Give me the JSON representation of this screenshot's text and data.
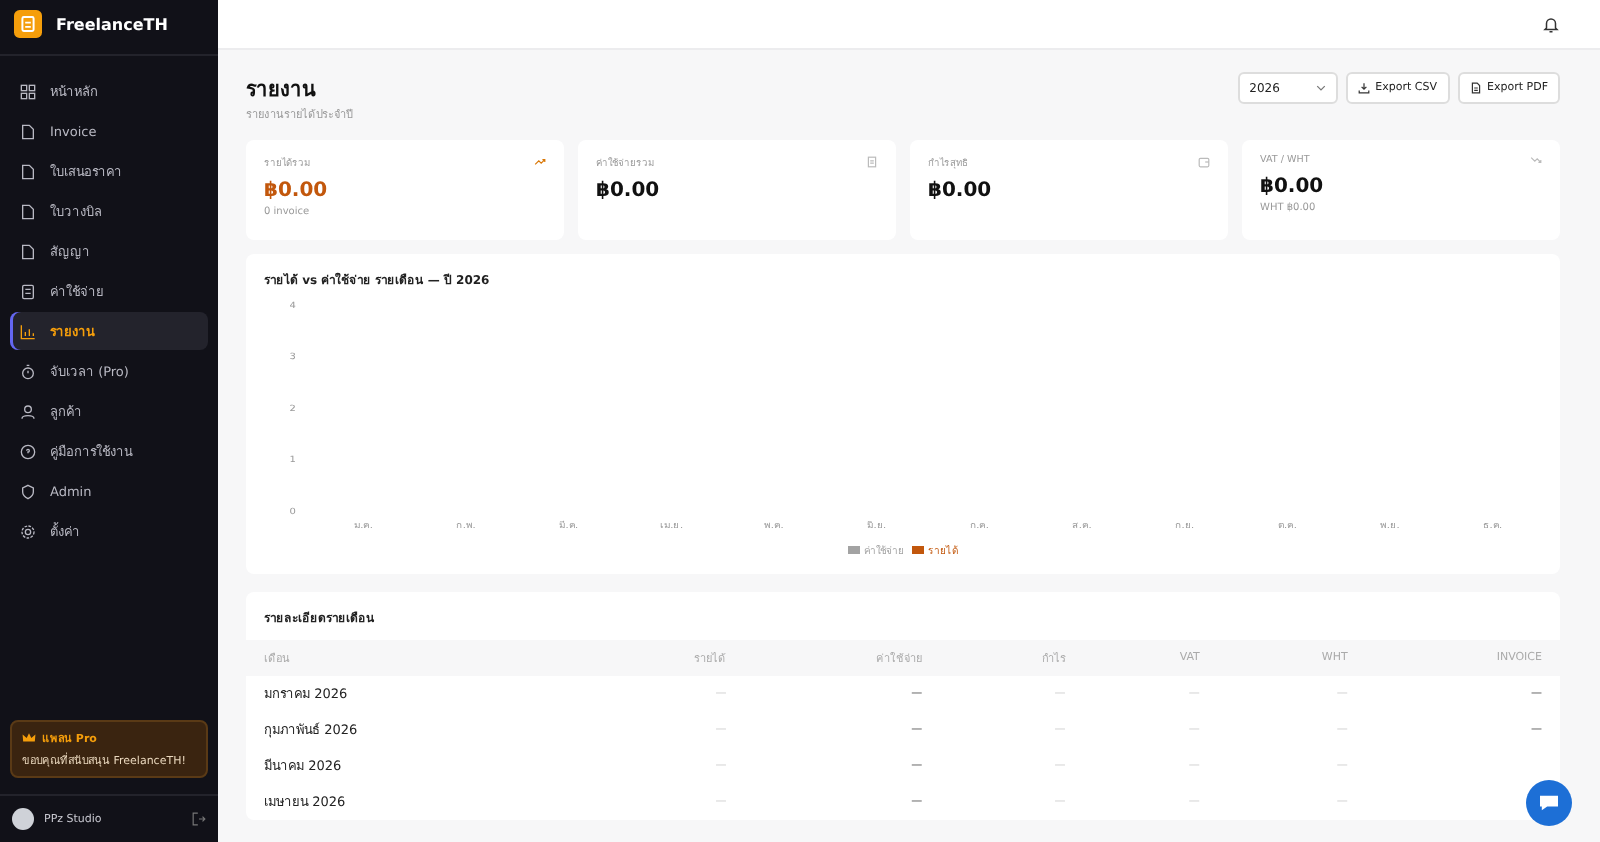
{
  "brand": {
    "name": "FreelanceTH"
  },
  "sidebar": {
    "items": [
      {
        "label": "หน้าหลัก",
        "selected": false
      },
      {
        "label": "Invoice",
        "selected": false
      },
      {
        "label": "ใบเสนอราคา",
        "selected": false
      },
      {
        "label": "ใบวางบิล",
        "selected": false
      },
      {
        "label": "สัญญา",
        "selected": false
      },
      {
        "label": "ค่าใช้จ่าย",
        "selected": false
      },
      {
        "label": "รายงาน",
        "selected": true
      },
      {
        "label": "จับเวลา (Pro)",
        "selected": false
      },
      {
        "label": "ลูกค้า",
        "selected": false
      },
      {
        "label": "คู่มือการใช้งาน",
        "selected": false
      },
      {
        "label": "Admin",
        "selected": false
      },
      {
        "label": "ตั้งค่า",
        "selected": false
      }
    ],
    "plan": {
      "title": "แพลน Pro",
      "text": "ขอบคุณที่สนับสนุน FreelanceTH!"
    },
    "user": {
      "name": "PPz Studio"
    }
  },
  "page": {
    "title": "รายงาน",
    "subtitle": "รายงานรายได้ประจำปี",
    "year": "2026",
    "buttons": [
      "Export CSV",
      "Export PDF"
    ]
  },
  "cards": [
    {
      "label": "รายได้รวม",
      "value": "฿0.00",
      "note": "0 invoice",
      "kind": "income"
    },
    {
      "label": "ค่าใช้จ่ายรวม",
      "value": "฿0.00",
      "kind": "expense"
    },
    {
      "label": "กำไรสุทธิ",
      "value": "฿0.00",
      "kind": "profit"
    },
    {
      "label": "VAT / WHT",
      "value": "฿0.00",
      "note": "WHT ฿0.00",
      "kind": "tax"
    }
  ],
  "chart": {
    "chart_data": {
      "type": "bar",
      "title": "รายได้ vs ค่าใช้จ่าย รายเดือน — ปี 2026",
      "categories": [
        "ม.ค.",
        "ก.พ.",
        "มี.ค.",
        "เม.ย.",
        "พ.ค.",
        "มิ.ย.",
        "ก.ค.",
        "ส.ค.",
        "ก.ย.",
        "ต.ค.",
        "พ.ย.",
        "ธ.ค."
      ],
      "series": [
        {
          "name": "ค่าใช้จ่าย",
          "color": "#a3a3a3",
          "values": [
            0,
            0,
            0,
            0,
            0,
            0,
            0,
            0,
            0,
            0,
            0,
            0
          ]
        },
        {
          "name": "รายได้",
          "color": "#c2570c",
          "values": [
            0,
            0,
            0,
            0,
            0,
            0,
            0,
            0,
            0,
            0,
            0,
            0
          ]
        }
      ],
      "ylim": [
        0,
        4
      ],
      "yticks": [
        0,
        1,
        2,
        3,
        4
      ]
    }
  },
  "table": {
    "title": "รายละเอียดรายเดือน",
    "columns": [
      "เดือน",
      "รายได้",
      "ค่าใช้จ่าย",
      "กำไร",
      "VAT",
      "WHT",
      "INVOICE"
    ],
    "rows": [
      [
        "มกราคม 2026",
        "—",
        "—",
        "—",
        "—",
        "—",
        "—"
      ],
      [
        "กุมภาพันธ์ 2026",
        "—",
        "—",
        "—",
        "—",
        "—",
        "—"
      ],
      [
        "มีนาคม 2026",
        "—",
        "—",
        "—",
        "—",
        "—"
      ],
      [
        "เมษายน 2026",
        "—",
        "—",
        "—",
        "—",
        "—"
      ]
    ]
  }
}
